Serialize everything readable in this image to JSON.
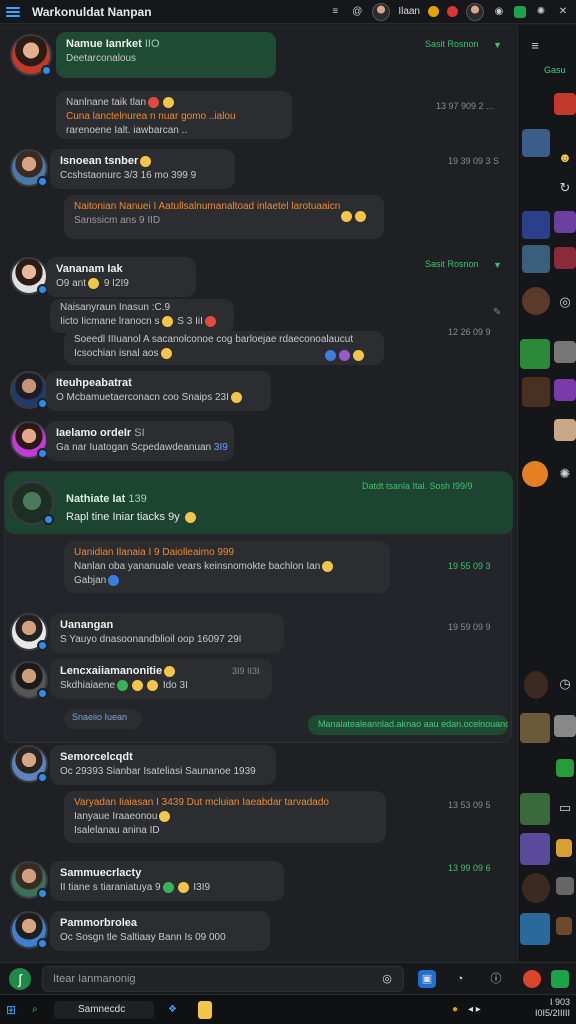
{
  "window": {
    "title": "Warkonuldat Nanpan",
    "user_label": "Ilaan"
  },
  "sidebar_top_label": "Gasu",
  "messages": [
    {
      "name": "Namue Ianrket",
      "name_suffix": "IIO",
      "line1": "Deetarconalous",
      "time": "Sasit Rosnon",
      "time_green": true
    },
    {
      "name": "",
      "line1": "Nanlnane taik tlan",
      "line2": "Cuna lanctelnurea n nuar gomo ..ialou",
      "line3": "rarenoene Ialt. iawbarcan ..",
      "time": "13 97 909 2 ..."
    },
    {
      "name": "Isnoean tsnber",
      "line1": "Ccshstaonurc 3/3 16 mo 399 9",
      "time": "19 39 09 3 S"
    },
    {
      "name": "",
      "line1": "Naitonian Nanuei I Aatullsalnumanaltoad inlaetel larotuaaicn",
      "line2": "Sanssicm ans 9 IID",
      "time": ""
    },
    {
      "name": "Vananam Iak",
      "line1": "O9 ant",
      "line2": "9 I2I9",
      "time": "Sasit Rosnon",
      "time_green": true
    },
    {
      "name": "",
      "line1": "Naisanyraun Inasun :C.9",
      "line2": "Iicto Iicmane lranocn s",
      "line3": "S 3 IiI",
      "time": ""
    },
    {
      "name": "",
      "line1": "Soeedl IIIuanol A sacanolconoe cog barloejae rdaeconoalaucut",
      "line2": "Icsochian isnal aos",
      "time": "12 26 09 9"
    },
    {
      "name": "Iteuhpeabatrat",
      "line1": "O Mcbamuetaerconacn coo Snaips 23I",
      "time": ""
    },
    {
      "name": "Iaelamo ordeIr",
      "name_suffix": "SI",
      "line1": "Ga nar Iuatogan Scpedawdeanuan",
      "line2": "3I9",
      "time": ""
    },
    {
      "name": "Nathiate Iat",
      "name_suffix": "139",
      "line1": "Rapl tine Iniar tiacks 9y",
      "time": "Datdt tsanla Ital. Sosh I99/9",
      "time_green": true
    },
    {
      "name": "",
      "line1": "Uanidian Ilanaia I 9 Daiolleaimo 999",
      "line2": "Nanlan oba yananuale vears keinsnomokte bachlon Ian",
      "line3": "Gabjan",
      "time": "19 55 09 3"
    },
    {
      "name": "Uanangan",
      "line1": "S Yauyo dnasoonandblioil oop 16097 29I",
      "time": "19 59 09 9"
    },
    {
      "name": "Lencxaiiamanonitie",
      "line1": "Skdhiaiaene",
      "line2": "Ido 3I",
      "time": "3I9 II3I",
      "reply": "Snaeiio Iuean"
    },
    {
      "name": "",
      "line1": "Manaiatealeannlad.aknao aau edan.ocelnouanoas",
      "time": "",
      "green_pill": true
    },
    {
      "name": "Semorcelcqdt",
      "line1": "Oc 29393 Sianbar Isateliasi Saunanoe 1939",
      "time": ""
    },
    {
      "name": "",
      "line1": "Varyadan Iiaiasan I 3439 Dut mcluian Iaeabdar tarvadado",
      "line2": "Ianyaue Iraaeonou",
      "line3": "Isalelanau anina ID",
      "time": "13 53 09 5"
    },
    {
      "name": "Sammuecrlacty",
      "line1": "II tiane s tiaraniatuya 9",
      "line2": "I3I9",
      "time": "13 99 09 6"
    },
    {
      "name": "Pammorbrolea",
      "line1": "Oc Sosgn tle Saltiaay Bann",
      "line2": "Is 09 000",
      "time": ""
    }
  ],
  "input": {
    "placeholder": "Itear Ianmanonig"
  },
  "taskbar": {
    "search_label": "Samnecdc",
    "time": "I 903",
    "date": "I0I5/2IIIII"
  }
}
